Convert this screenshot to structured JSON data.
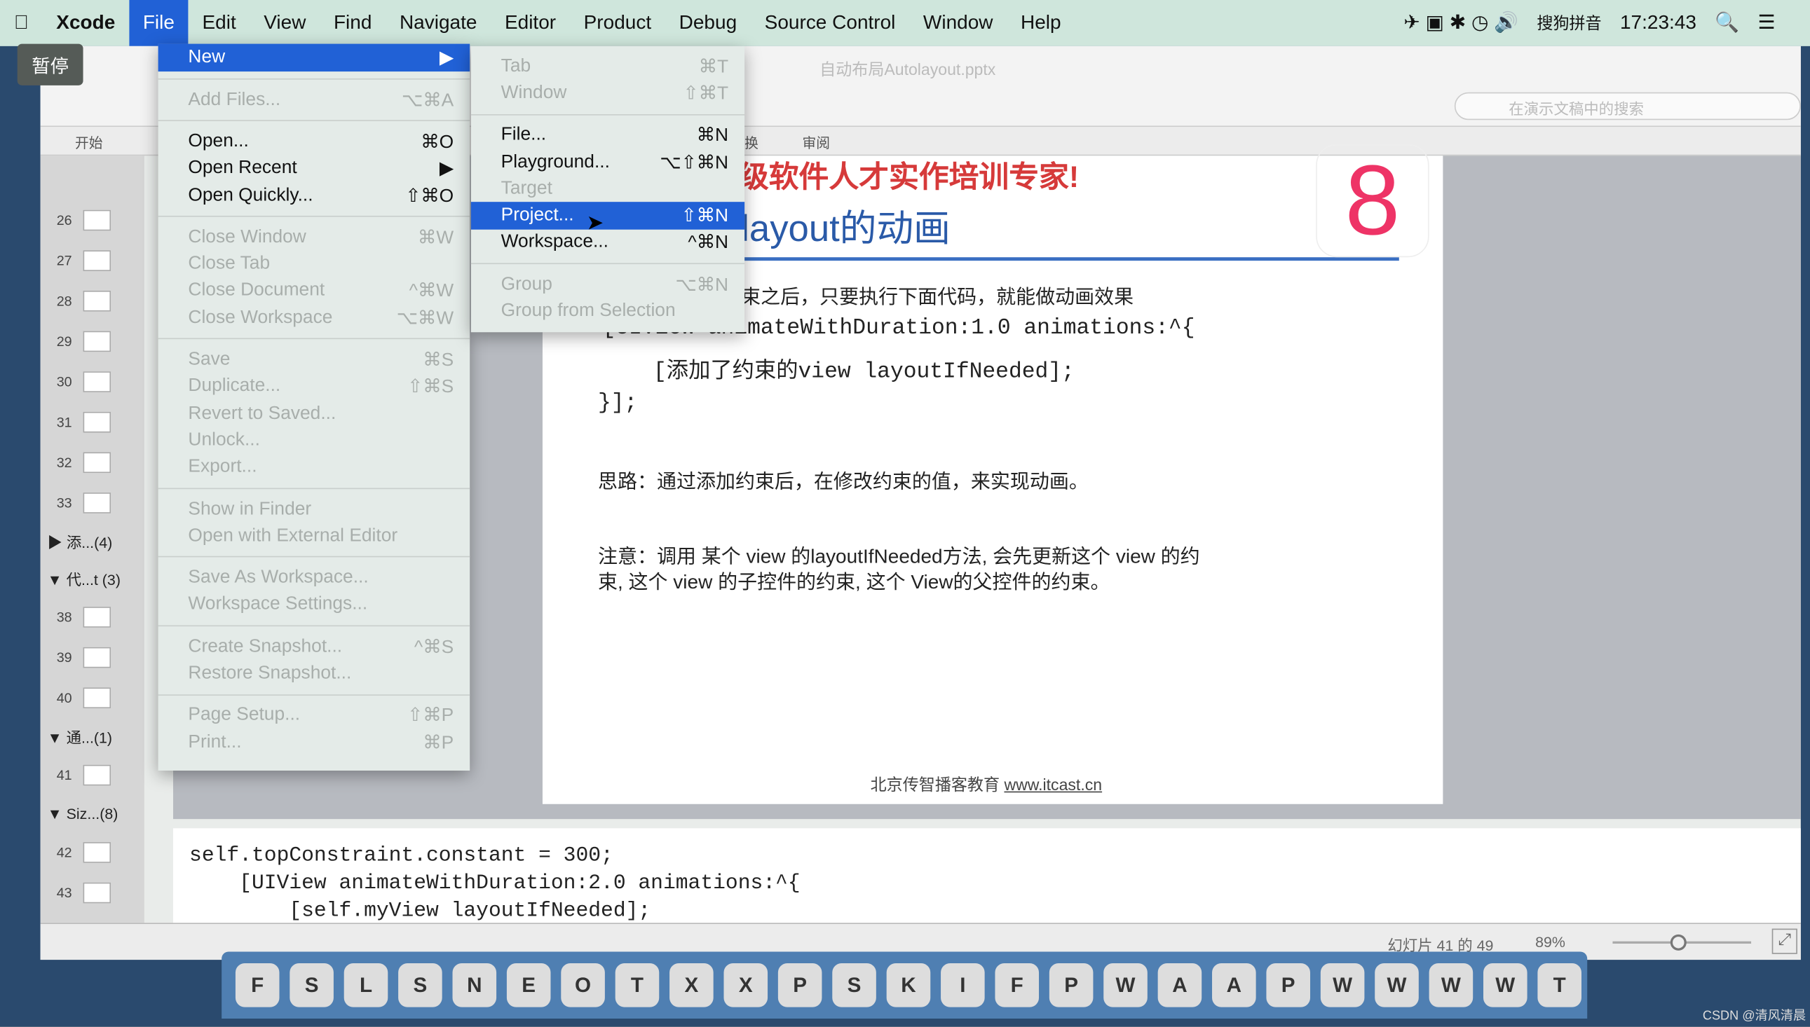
{
  "menubar": {
    "app": "Xcode",
    "items": [
      "File",
      "Edit",
      "View",
      "Find",
      "Navigate",
      "Editor",
      "Product",
      "Debug",
      "Source Control",
      "Window",
      "Help"
    ],
    "ime": "搜狗拼音",
    "clock": "17:23:43"
  },
  "overlay": {
    "pause": "暂停"
  },
  "file_menu": [
    {
      "label": "New",
      "shortcut": "▶",
      "state": "selected"
    },
    {
      "sep": true
    },
    {
      "label": "Add Files...",
      "shortcut": "⌥⌘A",
      "state": "disabled"
    },
    {
      "sep": true
    },
    {
      "label": "Open...",
      "shortcut": "⌘O",
      "state": "enabled"
    },
    {
      "label": "Open Recent",
      "shortcut": "▶",
      "state": "enabled"
    },
    {
      "label": "Open Quickly...",
      "shortcut": "⇧⌘O",
      "state": "enabled"
    },
    {
      "sep": true
    },
    {
      "label": "Close Window",
      "shortcut": "⌘W",
      "state": "disabled"
    },
    {
      "label": "Close Tab",
      "shortcut": "",
      "state": "disabled"
    },
    {
      "label": "Close Document",
      "shortcut": "^⌘W",
      "state": "disabled"
    },
    {
      "label": "Close Workspace",
      "shortcut": "⌥⌘W",
      "state": "disabled"
    },
    {
      "sep": true
    },
    {
      "label": "Save",
      "shortcut": "⌘S",
      "state": "disabled"
    },
    {
      "label": "Duplicate...",
      "shortcut": "⇧⌘S",
      "state": "disabled"
    },
    {
      "label": "Revert to Saved...",
      "shortcut": "",
      "state": "disabled"
    },
    {
      "label": "Unlock...",
      "shortcut": "",
      "state": "disabled"
    },
    {
      "label": "Export...",
      "shortcut": "",
      "state": "disabled"
    },
    {
      "sep": true
    },
    {
      "label": "Show in Finder",
      "shortcut": "",
      "state": "disabled"
    },
    {
      "label": "Open with External Editor",
      "shortcut": "",
      "state": "disabled"
    },
    {
      "sep": true
    },
    {
      "label": "Save As Workspace...",
      "shortcut": "",
      "state": "disabled"
    },
    {
      "label": "Workspace Settings...",
      "shortcut": "",
      "state": "disabled"
    },
    {
      "sep": true
    },
    {
      "label": "Create Snapshot...",
      "shortcut": "^⌘S",
      "state": "disabled"
    },
    {
      "label": "Restore Snapshot...",
      "shortcut": "",
      "state": "disabled"
    },
    {
      "sep": true
    },
    {
      "label": "Page Setup...",
      "shortcut": "⇧⌘P",
      "state": "disabled"
    },
    {
      "label": "Print...",
      "shortcut": "⌘P",
      "state": "disabled"
    }
  ],
  "new_submenu": [
    {
      "label": "Tab",
      "shortcut": "⌘T",
      "state": "disabled"
    },
    {
      "label": "Window",
      "shortcut": "⇧⌘T",
      "state": "disabled"
    },
    {
      "sep": true
    },
    {
      "label": "File...",
      "shortcut": "⌘N",
      "state": "enabled"
    },
    {
      "label": "Playground...",
      "shortcut": "⌥⇧⌘N",
      "state": "enabled"
    },
    {
      "label": "Target",
      "shortcut": "",
      "state": "disabled"
    },
    {
      "label": "Project...",
      "shortcut": "⇧⌘N",
      "state": "selected"
    },
    {
      "label": "Workspace...",
      "shortcut": "^⌘N",
      "state": "enabled"
    },
    {
      "sep": true
    },
    {
      "label": "Group",
      "shortcut": "⌥⌘N",
      "state": "disabled"
    },
    {
      "label": "Group from Selection",
      "shortcut": "",
      "state": "disabled"
    }
  ],
  "ppt": {
    "doc_title": "自动布局Autolayout.pptx",
    "search_placeholder": "在演示文稿中的搜索",
    "ribbon_tabs": [
      "开始",
      "换",
      "审阅"
    ],
    "sidebar": [
      {
        "num": "26"
      },
      {
        "num": "27"
      },
      {
        "num": "28"
      },
      {
        "num": "29"
      },
      {
        "num": "30"
      },
      {
        "num": "31"
      },
      {
        "num": "32"
      },
      {
        "num": "33"
      },
      {
        "group": "▶ 添...(4)"
      },
      {
        "group": "▼ 代...t (3)"
      },
      {
        "num": "38"
      },
      {
        "num": "39"
      },
      {
        "num": "40"
      },
      {
        "group": "▼ 通...(1)"
      },
      {
        "num": "41"
      },
      {
        "group": "▼ Siz...(8)"
      },
      {
        "num": "42"
      },
      {
        "num": "43"
      }
    ],
    "slide": {
      "banner": "级软件人才实作培训专家!",
      "title": "layout的动画",
      "logo": "8",
      "line1": "束之后，只要执行下面代码，就能做动画效果",
      "code1": "[UIView animateWithDuration:1.0 animations:^{",
      "code2": "[添加了约束的view layoutIfNeeded];",
      "code3": "}];",
      "idea": "思路：通过添加约束后，在修改约束的值，来实现动画。",
      "note1": "注意：调用 某个 view 的layoutIfNeeded方法, 会先更新这个 view 的约",
      "note2": "束, 这个 view 的子控件的约束, 这个 View的父控件的约束。",
      "footer": "北京传智播客教育",
      "footer_link": "www.itcast.cn"
    },
    "notes": "self.topConstraint.constant = 300;\n    [UIView animateWithDuration:2.0 animations:^{\n        [self.myView layoutIfNeeded];",
    "status": {
      "slide_count": "幻灯片 41 的 49",
      "zoom": "89%",
      "zoom_level": 89
    }
  },
  "dock": [
    "finder",
    "system-preferences",
    "launchpad",
    "safari",
    "notes",
    "excel",
    "onenote",
    "terminal",
    "xcode",
    "xcode-alt",
    "powerpoint",
    "scissors",
    "keynote",
    "instruments",
    "filezilla",
    "photoshop",
    "word",
    "app-a",
    "app-b",
    "preview",
    "window-1",
    "window-2",
    "window-3",
    "window-4",
    "trash"
  ],
  "watermark": "CSDN @清风清晨"
}
